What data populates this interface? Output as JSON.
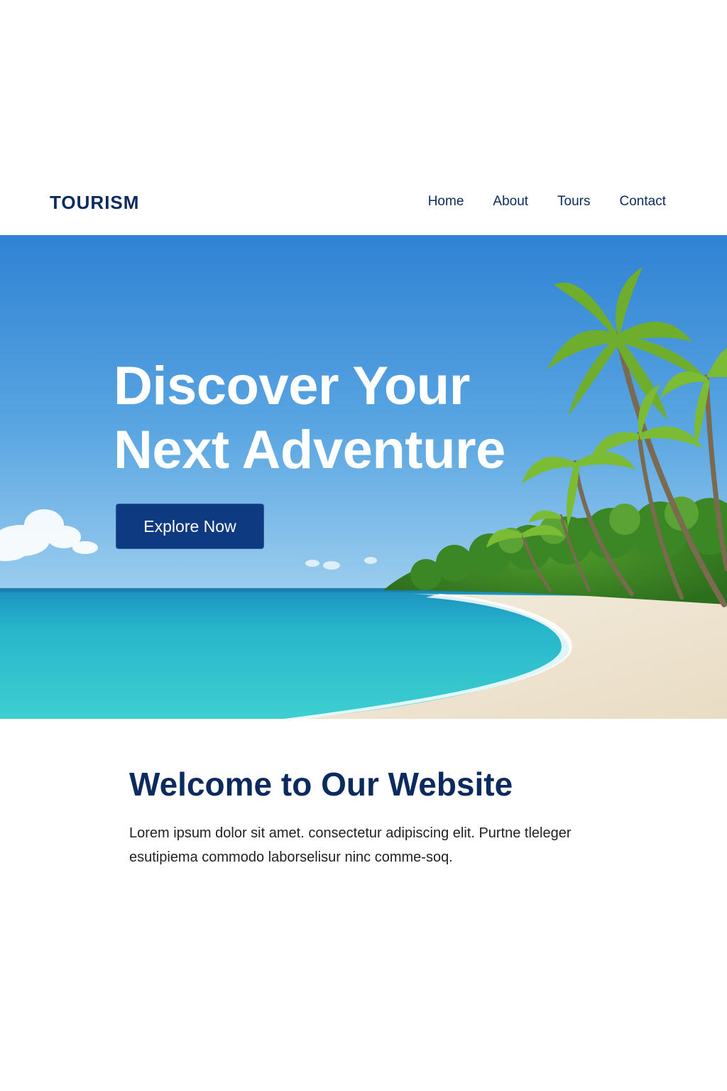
{
  "header": {
    "logo": "TOURISM",
    "nav": [
      {
        "label": "Home"
      },
      {
        "label": "About"
      },
      {
        "label": "Tours"
      },
      {
        "label": "Contact"
      }
    ]
  },
  "hero": {
    "title_line1": "Discover Your",
    "title_line2": "Next Adventure",
    "cta_label": "Explore Now",
    "image": "tropical-beach-with-palm-trees"
  },
  "welcome": {
    "heading": "Welcome to Our Website",
    "body": "Lorem ipsum dolor sit amet. consectetur adipiscing elit. Purtne tleleger esutipiema commodo laborselisur ninc comme-soq."
  },
  "colors": {
    "brand_navy": "#0b2a5e",
    "button_bg": "#0d3a80",
    "sky_top": "#2f82d4",
    "sea": "#27c0d0",
    "sand": "#efe6d6"
  }
}
